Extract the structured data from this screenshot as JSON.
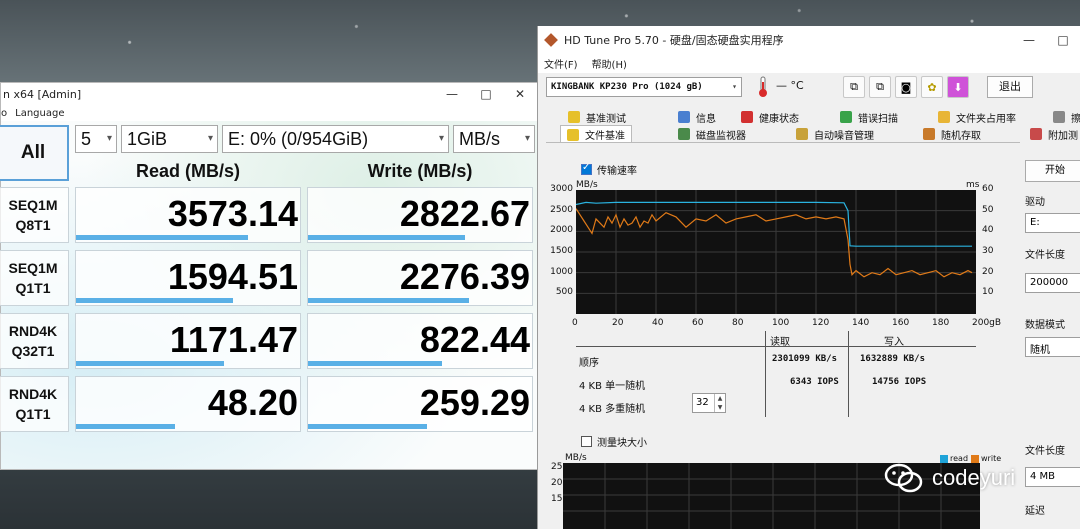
{
  "cdm": {
    "title": "n x64 [Admin]",
    "menu": [
      "o",
      "Language"
    ],
    "window_controls": [
      "—",
      "□",
      "✕"
    ],
    "all_button": "All",
    "count": "5",
    "size": "1GiB",
    "drive": "E: 0% (0/954GiB)",
    "unit": "MB/s",
    "read_header": "Read (MB/s)",
    "write_header": "Write (MB/s)",
    "rows": [
      {
        "line1": "SEQ1M",
        "line2": "Q8T1",
        "read": "3573.14",
        "write": "2822.67",
        "read_fill": 0.77,
        "write_fill": 0.7
      },
      {
        "line1": "SEQ1M",
        "line2": "Q1T1",
        "read": "1594.51",
        "write": "2276.39",
        "read_fill": 0.7,
        "write_fill": 0.72
      },
      {
        "line1": "RND4K",
        "line2": "Q32T1",
        "read": "1171.47",
        "write": "822.44",
        "read_fill": 0.66,
        "write_fill": 0.6
      },
      {
        "line1": "RND4K",
        "line2": "Q1T1",
        "read": "48.20",
        "write": "259.29",
        "read_fill": 0.44,
        "write_fill": 0.53
      }
    ]
  },
  "hdtune": {
    "title": "HD Tune Pro 5.70 - 硬盘/固态硬盘实用程序",
    "window_controls": [
      "—",
      "□"
    ],
    "menu": [
      "文件(F)",
      "帮助(H)"
    ],
    "drive_select": "KINGBANK KP230 Pro (1024 gB)",
    "temperature": "— °C",
    "exit": "退出",
    "tabs_row1": [
      "基准测试",
      "信息",
      "健康状态",
      "错误扫描",
      "文件夹占用率",
      "擦"
    ],
    "tabs_row2": [
      "文件基准",
      "磁盘监视器",
      "自动噪音管理",
      "随机存取",
      "附加测"
    ],
    "transfer_rate": "传输速率",
    "block_size": "测量块大小",
    "start": "开始",
    "drive_label": "驱动",
    "drive_value": "E:",
    "file_length_label": "文件长度",
    "file_length_value": "200000",
    "data_mode_label": "数据模式",
    "data_mode_value": "随机",
    "file_length_label2": "文件长度",
    "file_length_value2": "4 MB",
    "delay_label": "延迟",
    "results": {
      "col_read": "读取",
      "col_write": "写入",
      "rows": [
        {
          "label": "顺序",
          "read": "2301099 KB/s",
          "write": "1632889 KB/s"
        },
        {
          "label": "4 KB 单一随机",
          "read": "6343 IOPS",
          "write": "14756 IOPS"
        },
        {
          "label": "4 KB 多重随机",
          "read": "",
          "write": ""
        }
      ],
      "queue_depth": "32"
    },
    "legend2": {
      "read": "read",
      "write": "write",
      "read_color": "#1fa3d8",
      "write_color": "#e07a18"
    },
    "graph2_unit": "MB/s",
    "graph2_yticks": [
      "25",
      "20",
      "15"
    ]
  },
  "chart_data": {
    "type": "line",
    "xlabel": "",
    "ylabel": "MB/s",
    "y2label": "ms",
    "xlim": [
      0,
      200
    ],
    "ylim": [
      0,
      3000
    ],
    "y2lim": [
      0,
      60
    ],
    "x_ticks": [
      "0",
      "20",
      "40",
      "60",
      "80",
      "100",
      "120",
      "140",
      "160",
      "180",
      "200gB"
    ],
    "y_ticks": [
      "3000",
      "2500",
      "2000",
      "1500",
      "1000",
      "500"
    ],
    "y2_ticks": [
      "60",
      "50",
      "40",
      "30",
      "20",
      "10"
    ],
    "grid": true,
    "series": [
      {
        "color": "#2ab3e0",
        "x": [
          0,
          5,
          10,
          20,
          40,
          60,
          80,
          100,
          120,
          134,
          136,
          137,
          140,
          160,
          180,
          198
        ],
        "values": [
          2650,
          2700,
          2680,
          2700,
          2700,
          2700,
          2700,
          2700,
          2700,
          2690,
          2500,
          1650,
          1640,
          1640,
          1640,
          1640
        ]
      },
      {
        "color": "#e07a18",
        "x": [
          0,
          2,
          4,
          6,
          8,
          10,
          12,
          14,
          16,
          18,
          20,
          22,
          24,
          26,
          28,
          30,
          32,
          34,
          36,
          38,
          40,
          45,
          50,
          55,
          60,
          65,
          70,
          75,
          80,
          85,
          90,
          95,
          100,
          105,
          110,
          115,
          120,
          125,
          130,
          134,
          136,
          137,
          138,
          140,
          144,
          148,
          152,
          156,
          160,
          164,
          168,
          172,
          176,
          180,
          184,
          188,
          192,
          196,
          198
        ],
        "values": [
          2550,
          2400,
          2250,
          2100,
          1950,
          2300,
          2200,
          2100,
          2350,
          2200,
          2400,
          2100,
          2300,
          2150,
          2200,
          2350,
          2100,
          2250,
          2200,
          2400,
          2250,
          2450,
          2350,
          2100,
          2300,
          2250,
          2400,
          2200,
          2300,
          2350,
          2400,
          2250,
          2300,
          2350,
          2400,
          2300,
          2350,
          2300,
          2350,
          2300,
          1800,
          1200,
          950,
          1050,
          900,
          1000,
          950,
          1100,
          950,
          1000,
          1050,
          950,
          1000,
          1050,
          900,
          1000,
          950,
          1050,
          1000
        ]
      }
    ]
  }
}
